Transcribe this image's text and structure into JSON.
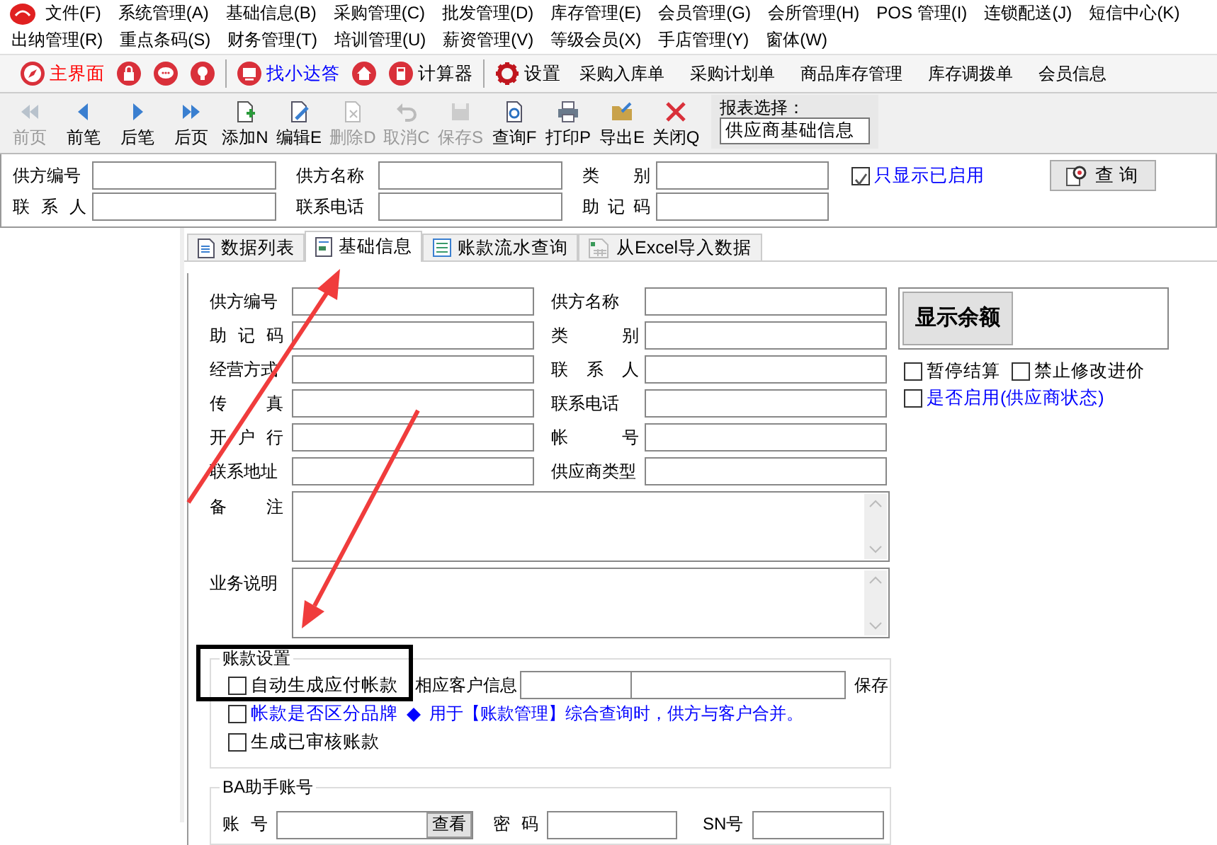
{
  "menu_rows": [
    {
      "items": [
        "文件(F)",
        "系统管理(A)",
        "基础信息(B)",
        "采购管理(C)",
        "批发管理(D)",
        "库存管理(E)",
        "会员管理(G)",
        "会所管理(H)",
        "POS 管理(I)",
        "连锁配送(J)",
        "短信中心(K)"
      ]
    },
    {
      "items": [
        "出纳管理(R)",
        "重点条码(S)",
        "财务管理(T)",
        "培训管理(U)",
        "薪资管理(V)",
        "等级会员(X)",
        "手店管理(Y)",
        "窗体(W)"
      ]
    }
  ],
  "quick_bar": [
    {
      "kind": "button",
      "label": "主界面",
      "color": "#ff0000"
    },
    {
      "kind": "icon"
    },
    {
      "kind": "icon"
    },
    {
      "kind": "icon"
    },
    {
      "kind": "divider"
    },
    {
      "kind": "button",
      "label": "找小达答",
      "color": "#0000ff"
    },
    {
      "kind": "icon"
    },
    {
      "kind": "button",
      "label": "计算器",
      "color": "#000000"
    },
    {
      "kind": "divider"
    },
    {
      "kind": "button",
      "label": "设置",
      "color": "#000000"
    },
    {
      "kind": "text",
      "label": "采购入库单",
      "color": "#000000"
    },
    {
      "kind": "text",
      "label": "采购计划单",
      "color": "#000000"
    },
    {
      "kind": "text",
      "label": "商品库存管理",
      "color": "#000000"
    },
    {
      "kind": "text",
      "label": "库存调拨单",
      "color": "#000000"
    },
    {
      "kind": "text",
      "label": "会员信息",
      "color": "#000000"
    }
  ],
  "toolbar": [
    {
      "label": "前页",
      "disabled": true
    },
    {
      "label": "前笔",
      "disabled": false
    },
    {
      "label": "后笔",
      "disabled": false
    },
    {
      "label": "后页",
      "disabled": false
    },
    {
      "label": "添加N",
      "disabled": false
    },
    {
      "label": "编辑E",
      "disabled": false
    },
    {
      "label": "删除D",
      "disabled": true
    },
    {
      "label": "取消C",
      "disabled": true
    },
    {
      "label": "保存S",
      "disabled": true
    },
    {
      "label": "查询F",
      "disabled": false
    },
    {
      "label": "打印P",
      "disabled": false
    },
    {
      "label": "导出E",
      "disabled": false
    },
    {
      "label": "关闭Q",
      "disabled": false
    }
  ],
  "report_select": {
    "label": "报表选择：",
    "value": "供应商基础信息"
  },
  "search": {
    "fields": [
      "供方编号",
      "供方名称",
      "类 别",
      "联 系 人",
      "联系电话",
      "助 记 码"
    ],
    "only_enabled": {
      "label": "只显示已启用",
      "checked": true
    },
    "button": "查 询"
  },
  "tabs": [
    {
      "label": "数据列表",
      "selected": false
    },
    {
      "label": "基础信息",
      "selected": true
    },
    {
      "label": "账款流水查询",
      "selected": false
    },
    {
      "label": "从Excel导入数据",
      "selected": false
    }
  ],
  "form": {
    "rows": [
      [
        "供方编号",
        "供方名称"
      ],
      [
        "助 记 码",
        "类 别"
      ],
      [
        "经营方式",
        "联 系 人"
      ],
      [
        "传 真",
        "联系电话"
      ],
      [
        "开 户 行",
        "帐 号"
      ],
      [
        "联系地址",
        "供应商类型"
      ]
    ],
    "notes": [
      "备 注",
      "业务说明"
    ],
    "balance_button": "显示余额",
    "options": [
      {
        "label": "暂停结算",
        "checked": false,
        "color": "#000000"
      },
      {
        "label": "禁止修改进价",
        "checked": false,
        "color": "#000000"
      },
      {
        "label": "是否启用(供应商状态)",
        "checked": false,
        "color": "#0000ff"
      }
    ]
  },
  "account_settings": {
    "legend": "账款设置",
    "auto_payable": {
      "label": "自动生成应付帐款",
      "checked": false
    },
    "customer_label": "相应客户信息",
    "save": "保存",
    "by_brand": {
      "label": "帐款是否区分品牌",
      "checked": false
    },
    "note": "用于【账款管理】综合查询时，供方与客户合并。",
    "audited": {
      "label": "生成已审核账款",
      "checked": false
    }
  },
  "ba_account": {
    "legend": "BA助手账号",
    "account_label": "账 号",
    "view_button": "查看",
    "password_label": "密 码",
    "sn_label": "SN号"
  }
}
